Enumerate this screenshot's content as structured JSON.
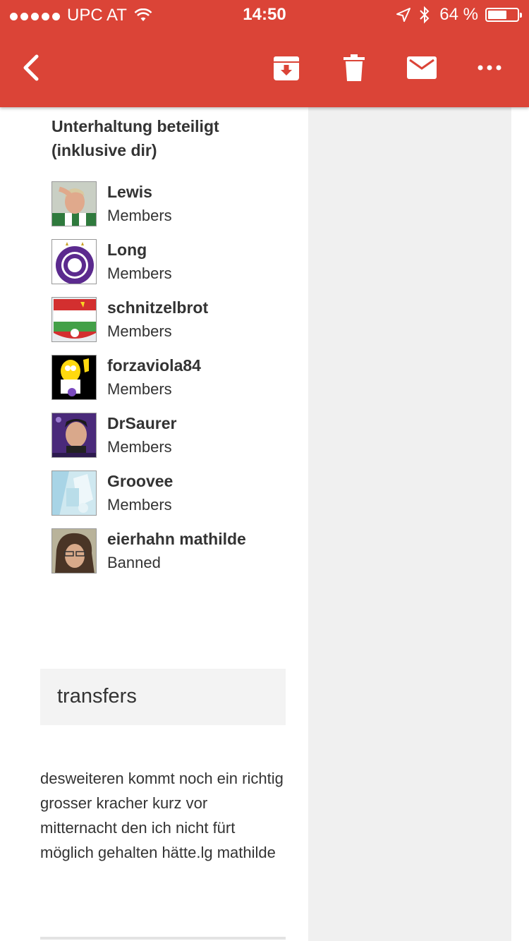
{
  "status_bar": {
    "carrier": "UPC AT",
    "time": "14:50",
    "battery_percent": "64 %",
    "battery_level": 0.64
  },
  "toolbar": {
    "icons": [
      "back-chevron-icon",
      "archive-icon",
      "trash-icon",
      "mail-icon",
      "more-icon"
    ]
  },
  "participants": {
    "heading": "Unterhaltung beteiligt (inklusive dir)",
    "members": [
      {
        "name": "Lewis",
        "role": "Members"
      },
      {
        "name": "Long",
        "role": "Members"
      },
      {
        "name": "schnitzelbrot",
        "role": "Members"
      },
      {
        "name": "forzaviola84",
        "role": "Members"
      },
      {
        "name": "DrSaurer",
        "role": "Members"
      },
      {
        "name": "Groovee",
        "role": "Members"
      },
      {
        "name": "eierhahn mathilde",
        "role": "Banned"
      }
    ]
  },
  "post": {
    "title": "transfers",
    "body": "desweiteren kommt noch ein richtig grosser kracher kurz vor mitternacht den ich nicht fürt möglich gehalten hätte.lg mathilde"
  },
  "colors": {
    "accent": "#db4437",
    "side_column": "#f0f0f0",
    "title_box": "#f3f3f3",
    "text": "#333333"
  }
}
